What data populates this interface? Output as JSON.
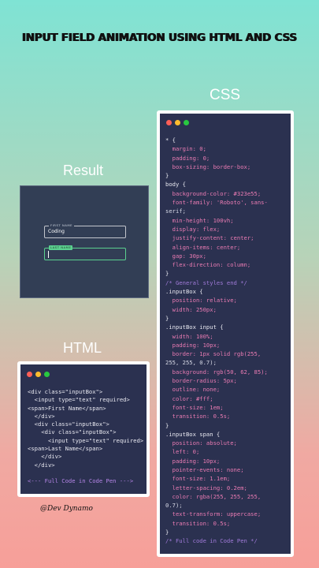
{
  "title": "INPUT  FIELD ANIMATION USING HTML AND CSS",
  "labels": {
    "css": "CSS",
    "result": "Result",
    "html": "HTML"
  },
  "colors": {
    "dot_red": "#ff5f57",
    "dot_yellow": "#febc2e",
    "dot_green": "#28c840"
  },
  "result": {
    "first_label": "FIRST NAME",
    "first_value": "Coding",
    "last_label": "LAST NAME",
    "last_value": ""
  },
  "css_code": [
    {
      "t": "* {",
      "c": "sel"
    },
    {
      "t": "  margin: 0;",
      "c": "prop"
    },
    {
      "t": "  padding: 0;",
      "c": "prop"
    },
    {
      "t": "  box-sizing: border-box;",
      "c": "prop"
    },
    {
      "t": "}",
      "c": "sel"
    },
    {
      "t": "body {",
      "c": "sel"
    },
    {
      "t": "  background-color: #323e55;",
      "c": "prop"
    },
    {
      "t": "  font-family: 'Roboto', sans-",
      "c": "prop"
    },
    {
      "t": "serif;",
      "c": "val"
    },
    {
      "t": "  min-height: 100vh;",
      "c": "prop"
    },
    {
      "t": "  display: flex;",
      "c": "prop"
    },
    {
      "t": "  justify-content: center;",
      "c": "prop"
    },
    {
      "t": "  align-items: center;",
      "c": "prop"
    },
    {
      "t": "  gap: 30px;",
      "c": "prop"
    },
    {
      "t": "  flex-direction: column;",
      "c": "prop"
    },
    {
      "t": "}",
      "c": "sel"
    },
    {
      "t": "/* General styles end */",
      "c": "cmt"
    },
    {
      "t": ".inputBox {",
      "c": "sel"
    },
    {
      "t": "  position: relative;",
      "c": "prop"
    },
    {
      "t": "  width: 250px;",
      "c": "prop"
    },
    {
      "t": "}",
      "c": "sel"
    },
    {
      "t": ".inputBox input {",
      "c": "sel"
    },
    {
      "t": "  width: 100%;",
      "c": "prop"
    },
    {
      "t": "  padding: 10px;",
      "c": "prop"
    },
    {
      "t": "  border: 1px solid rgb(255,",
      "c": "prop"
    },
    {
      "t": "255, 255, 0.7);",
      "c": "val"
    },
    {
      "t": "  background: rgb(50, 62, 85);",
      "c": "prop"
    },
    {
      "t": "  border-radius: 5px;",
      "c": "prop"
    },
    {
      "t": "  outline: none;",
      "c": "prop"
    },
    {
      "t": "  color: #fff;",
      "c": "prop"
    },
    {
      "t": "  font-size: 1em;",
      "c": "prop"
    },
    {
      "t": "  transition: 0.5s;",
      "c": "prop"
    },
    {
      "t": "}",
      "c": "sel"
    },
    {
      "t": ".inputBox span {",
      "c": "sel"
    },
    {
      "t": "  position: absolute;",
      "c": "prop"
    },
    {
      "t": "  left: 0;",
      "c": "prop"
    },
    {
      "t": "  padding: 10px;",
      "c": "prop"
    },
    {
      "t": "  pointer-events: none;",
      "c": "prop"
    },
    {
      "t": "  font-size: 1.1em;",
      "c": "prop"
    },
    {
      "t": "  letter-spacing: 0.2em;",
      "c": "prop"
    },
    {
      "t": "  color: rgba(255, 255, 255,",
      "c": "prop"
    },
    {
      "t": "0.7);",
      "c": "val"
    },
    {
      "t": "  text-transform: uppercase;",
      "c": "prop"
    },
    {
      "t": "  transition: 0.5s;",
      "c": "prop"
    },
    {
      "t": "}",
      "c": "sel"
    },
    {
      "t": "/* Full code in Code Pen */",
      "c": "cmt"
    }
  ],
  "html_code": [
    {
      "t": "<div class=\"inputBox\">",
      "c": "tag"
    },
    {
      "t": "  <input type=\"text\" required>",
      "c": "tag"
    },
    {
      "t": "<span>First Name</span>",
      "c": "tag"
    },
    {
      "t": "  </div>",
      "c": "tag"
    },
    {
      "t": "  <div class=\"inputBox\">",
      "c": "tag"
    },
    {
      "t": "    <div class=\"inputBox\">",
      "c": "tag"
    },
    {
      "t": "      <input type=\"text\" required>",
      "c": "tag"
    },
    {
      "t": "<span>Last Name</span>",
      "c": "tag"
    },
    {
      "t": "    </div>",
      "c": "tag"
    },
    {
      "t": "  </div>",
      "c": "tag"
    },
    {
      "t": "",
      "c": "tag"
    },
    {
      "t": "<--- Full Code in Code Pen --->",
      "c": "link"
    }
  ],
  "credit": "@Dev Dynamo"
}
